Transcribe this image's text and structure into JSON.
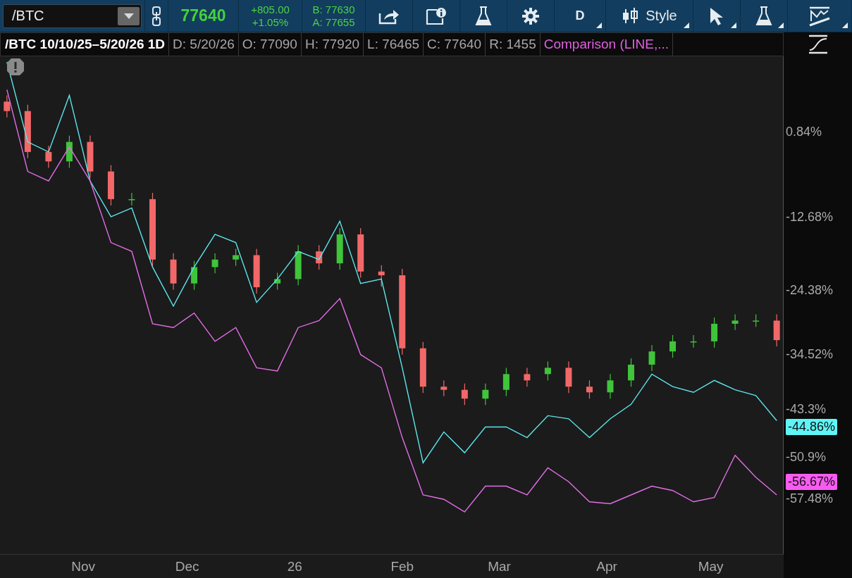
{
  "toolbar": {
    "symbol": "/BTC",
    "last": "77640",
    "change": "+805.00",
    "change_pct": "+1.05%",
    "bid": "B: 77630",
    "ask": "A: 77655",
    "buttons": [
      {
        "kind": "share",
        "has_menu": false
      },
      {
        "kind": "info",
        "has_menu": false
      },
      {
        "kind": "flask",
        "has_menu": false
      },
      {
        "kind": "gear",
        "has_menu": false
      },
      {
        "kind": "text",
        "label": "D",
        "has_menu": true
      },
      {
        "kind": "style",
        "label": "Style",
        "has_menu": true
      },
      {
        "kind": "cursor",
        "has_menu": true
      },
      {
        "kind": "flask",
        "has_menu": true
      },
      {
        "kind": "drawing",
        "has_menu": true
      }
    ]
  },
  "header": {
    "title": "/BTC 10/10/25–5/20/26 1D",
    "fields": [
      "D: 5/20/26",
      "O: 77090",
      "H: 77920",
      "L: 76465",
      "C: 77640",
      "R: 1455"
    ],
    "study": "Comparison (LINE,..."
  },
  "chart": {
    "chart_data": {
      "type": "candlestick",
      "x": [
        "2025-10-10",
        "2025-10-16",
        "2025-10-22",
        "2025-10-28",
        "2025-11-03",
        "2025-11-09",
        "2025-11-15",
        "2025-11-21",
        "2025-11-27",
        "2025-12-03",
        "2025-12-09",
        "2025-12-15",
        "2025-12-21",
        "2025-12-27",
        "2026-01-02",
        "2026-01-08",
        "2026-01-14",
        "2026-01-20",
        "2026-01-26",
        "2026-02-01",
        "2026-02-07",
        "2026-02-13",
        "2026-02-19",
        "2026-02-25",
        "2026-03-03",
        "2026-03-09",
        "2026-03-15",
        "2026-03-21",
        "2026-03-27",
        "2026-04-02",
        "2026-04-08",
        "2026-04-14",
        "2026-04-20",
        "2026-04-26",
        "2026-05-02",
        "2026-05-08",
        "2026-05-14",
        "2026-05-20"
      ],
      "xlim": [
        "2025-10-08",
        "2026-05-22"
      ],
      "ylim": [
        -66.1,
        13
      ],
      "xticks": [
        {
          "value": "2025-11-01",
          "label": "Nov"
        },
        {
          "value": "2025-12-01",
          "label": "Dec"
        },
        {
          "value": "2026-01-01",
          "label": "26"
        },
        {
          "value": "2026-02-01",
          "label": "Feb"
        },
        {
          "value": "2026-03-01",
          "label": "Mar"
        },
        {
          "value": "2026-04-01",
          "label": "Apr"
        },
        {
          "value": "2026-05-01",
          "label": "May"
        }
      ],
      "yticks": [
        {
          "value": 0.84,
          "label": "0.84%"
        },
        {
          "value": -12.68,
          "label": "-12.68%"
        },
        {
          "value": -24.38,
          "label": "-24.38%"
        },
        {
          "value": -34.52,
          "label": "-34.52%"
        },
        {
          "value": -43.3,
          "label": "-43.3%"
        },
        {
          "value": -50.9,
          "label": "-50.9%"
        },
        {
          "value": -57.48,
          "label": "-57.48%"
        }
      ],
      "ohlc": [
        [
          5.8,
          6.8,
          3.3,
          4.3
        ],
        [
          4.3,
          5.3,
          -3.2,
          -2.2
        ],
        [
          -2.2,
          -1.2,
          -4.7,
          -3.7
        ],
        [
          -3.7,
          0.4,
          -4.7,
          -0.6
        ],
        [
          -0.6,
          0.4,
          -6.3,
          -5.3
        ],
        [
          -5.3,
          -4.3,
          -10.7,
          -9.7
        ],
        [
          -9.7,
          -8.7,
          -10.7,
          -9.7
        ],
        [
          -9.7,
          -8.7,
          -20.3,
          -19.3
        ],
        [
          -19.3,
          -18.3,
          -24.1,
          -23.1
        ],
        [
          -23.1,
          -19.5,
          -24.1,
          -20.5
        ],
        [
          -20.5,
          -18.3,
          -21.5,
          -19.3
        ],
        [
          -19.3,
          -17.6,
          -20.3,
          -18.6
        ],
        [
          -18.6,
          -17.6,
          -24.7,
          -23.7
        ],
        [
          -23.1,
          -21.4,
          -24.1,
          -22.4
        ],
        [
          -22.4,
          -17.0,
          -23.4,
          -18.0
        ],
        [
          -18.0,
          -17.0,
          -20.9,
          -19.9
        ],
        [
          -19.9,
          -14.3,
          -20.9,
          -15.3
        ],
        [
          -15.3,
          -14.3,
          -22.2,
          -21.2
        ],
        [
          -21.2,
          -20.2,
          -23.6,
          -21.8
        ],
        [
          -21.8,
          -20.8,
          -34.4,
          -33.4
        ],
        [
          -33.4,
          -32.4,
          -40.5,
          -39.5
        ],
        [
          -39.5,
          -38.5,
          -41.0,
          -40.0
        ],
        [
          -40.0,
          -39.0,
          -42.4,
          -41.4
        ],
        [
          -41.4,
          -39.0,
          -42.4,
          -40.0
        ],
        [
          -40.0,
          -36.5,
          -41.0,
          -37.5
        ],
        [
          -37.5,
          -36.5,
          -39.5,
          -38.5
        ],
        [
          -37.5,
          -35.5,
          -38.5,
          -36.5
        ],
        [
          -36.5,
          -35.5,
          -40.5,
          -39.5
        ],
        [
          -39.5,
          -38.5,
          -41.4,
          -40.4
        ],
        [
          -40.4,
          -37.5,
          -41.4,
          -38.5
        ],
        [
          -38.5,
          -35.0,
          -39.5,
          -36.0
        ],
        [
          -36.0,
          -32.9,
          -37.0,
          -33.9
        ],
        [
          -33.9,
          -31.3,
          -34.9,
          -32.3
        ],
        [
          -32.3,
          -31.3,
          -33.3,
          -32.3
        ],
        [
          -32.3,
          -28.5,
          -33.3,
          -29.5
        ],
        [
          -29.5,
          -28.0,
          -30.5,
          -29.0
        ],
        [
          -29.0,
          -28.0,
          -30.0,
          -29.0
        ],
        [
          -29.0,
          -28.0,
          -33.1,
          -32.1
        ]
      ],
      "series": [
        {
          "type": "line",
          "color": "#5ce6ec",
          "values": [
            12.1,
            -0.6,
            -2.2,
            6.8,
            -6.8,
            -12.5,
            -11.1,
            -20.5,
            -26.7,
            -20.5,
            -15.3,
            -16.6,
            -26.1,
            -22.4,
            -18.0,
            -19.3,
            -13.2,
            -23.1,
            -22.4,
            -36.5,
            -51.6,
            -46.7,
            -50.0,
            -45.9,
            -45.9,
            -47.6,
            -44.1,
            -44.6,
            -47.6,
            -44.6,
            -42.3,
            -37.5,
            -39.5,
            -40.4,
            -38.5,
            -40.0,
            -40.9,
            -44.9
          ]
        },
        {
          "type": "line",
          "color": "#e46ee8",
          "values": [
            7.7,
            -5.3,
            -6.8,
            -1.4,
            -6.8,
            -16.6,
            -18.0,
            -29.5,
            -30.1,
            -27.8,
            -32.3,
            -30.1,
            -36.5,
            -37.0,
            -30.1,
            -29.0,
            -25.5,
            -34.4,
            -36.5,
            -47.6,
            -56.7,
            -57.4,
            -59.4,
            -55.3,
            -55.3,
            -56.7,
            -52.4,
            -54.6,
            -57.8,
            -58.1,
            -56.7,
            -55.3,
            -56.0,
            -57.8,
            -57.1,
            -50.4,
            -53.9,
            -56.7
          ]
        }
      ]
    },
    "value_badges": [
      {
        "text": "-44.86%",
        "color": "#5ff5f7"
      },
      {
        "text": "-56.67%",
        "color": "#f65cf0"
      }
    ]
  }
}
